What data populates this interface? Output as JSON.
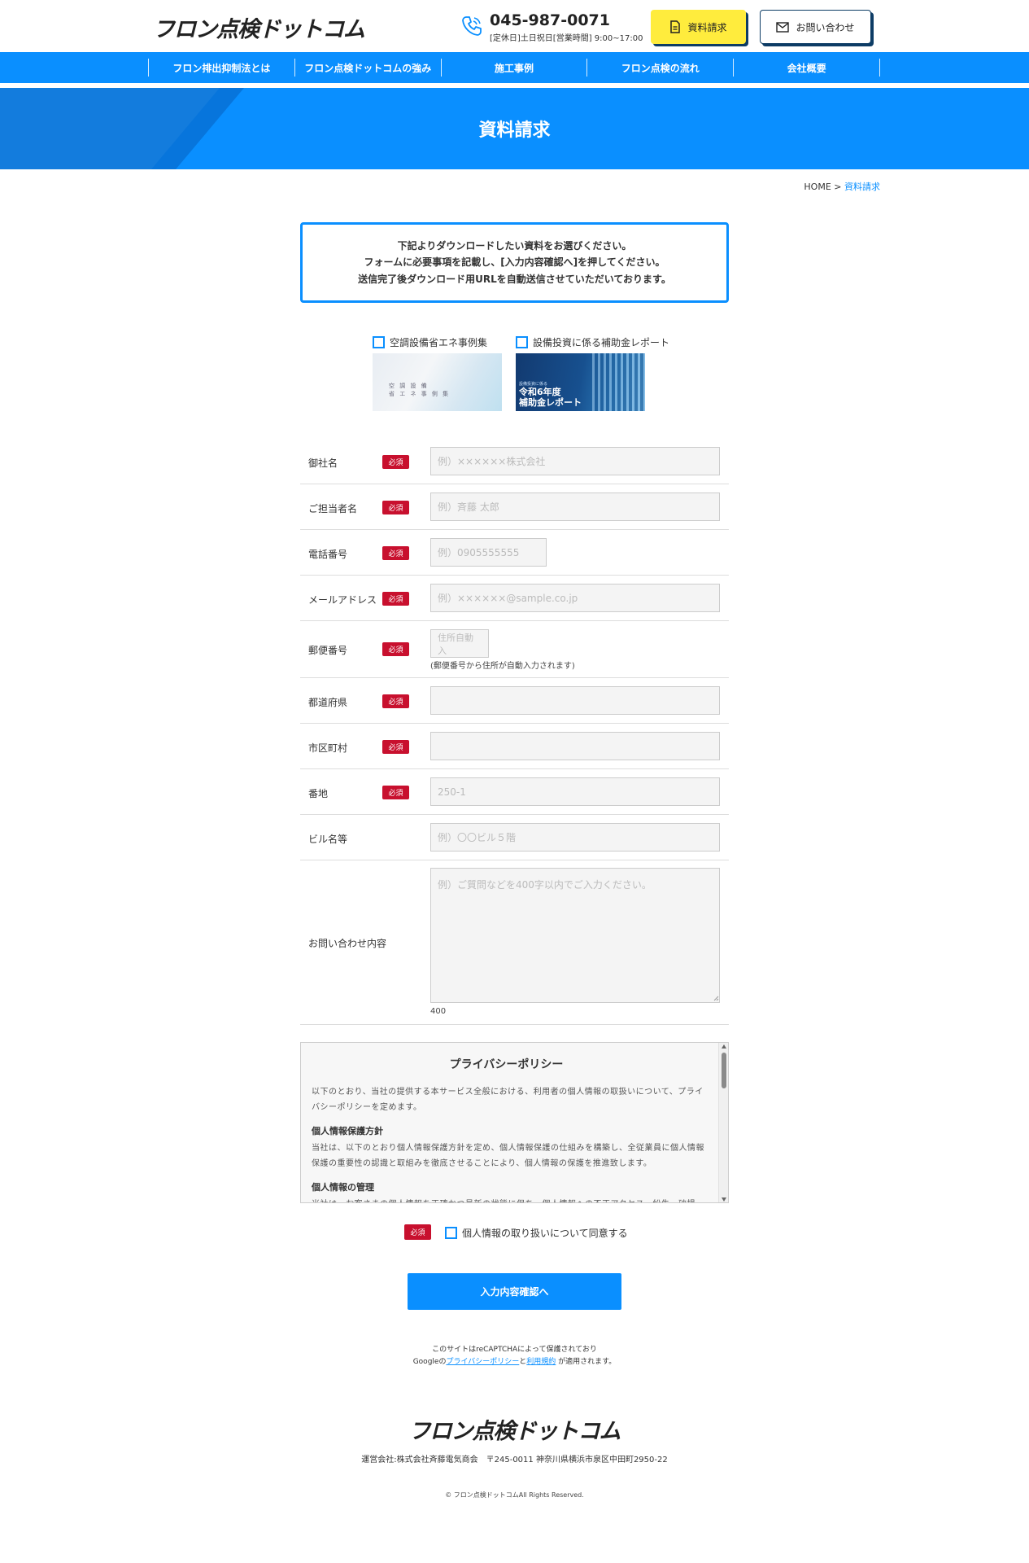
{
  "header": {
    "logo": "フロン点検ドットコム",
    "phone": "045-987-0071",
    "hours": "[定休日]土日祝日[営業時間] 9:00~17:00",
    "doc_button": "資料請求",
    "contact_button": "お問い合わせ",
    "accent_yellow": "#ffec3d",
    "accent_blue": "#0a8fff",
    "phone_icon": "phone-icon",
    "doc_icon": "document-icon",
    "mail_icon": "mail-icon"
  },
  "nav": {
    "items": [
      "フロン排出抑制法とは",
      "フロン点検ドットコムの強み",
      "施工事例",
      "フロン点検の流れ",
      "会社概要"
    ]
  },
  "hero": {
    "title": "資料請求"
  },
  "breadcrumb": {
    "home": "HOME",
    "separator": ">",
    "current": "資料請求"
  },
  "notice": {
    "lines": [
      "下記よりダウンロードしたい資料をお選びください。",
      "フォームに必要事項を記載し、[入力内容確認へ]を押してください。",
      "送信完了後ダウンロード用URLを自動送信させていただいております。"
    ]
  },
  "documents": [
    {
      "label": "空調設備省エネ事例集",
      "thumb_text": [
        "空 調 設 備",
        "省 エ ネ 事 例 集"
      ]
    },
    {
      "label": "設備投資に係る補助金レポート",
      "thumb_sub": "設備投資に係る",
      "thumb_text": [
        "令和6年度",
        "補助金レポート"
      ]
    }
  ],
  "form": {
    "required_badge": "必須",
    "fields": [
      {
        "label": "御社名",
        "placeholder": "例）××××××株式会社"
      },
      {
        "label": "ご担当者名",
        "placeholder": "例）斉藤 太郎"
      },
      {
        "label": "電話番号",
        "placeholder": "例）0905555555"
      },
      {
        "label": "メールアドレス",
        "placeholder": "例）××××××@sample.co.jp"
      },
      {
        "label": "郵便番号",
        "placeholder": "住所自動入",
        "note": "(郵便番号から住所が自動入力されます)"
      },
      {
        "label": "都道府県",
        "placeholder": ""
      },
      {
        "label": "市区町村",
        "placeholder": ""
      },
      {
        "label": "番地",
        "placeholder": "250-1"
      },
      {
        "label": "ビル名等",
        "placeholder": "例）〇〇ビル５階"
      },
      {
        "label": "お問い合わせ内容",
        "placeholder": "例）ご質問などを400字以内でご入力ください。",
        "counter": "400"
      }
    ]
  },
  "privacy": {
    "title": "プライバシーポリシー",
    "intro": "以下のとおり、当社の提供する本サービス全般における、利用者の個人情報の取扱いについて、プライバシーポリシーを定めます。",
    "section1_title": "個人情報保護方針",
    "section1_text": "当社は、以下のとおり個人情報保護方針を定め、個人情報保護の仕組みを構築し、全従業員に個人情報保護の重要性の認識と取組みを徹底させることにより、個人情報の保護を推進致します。",
    "section2_title": "個人情報の管理",
    "section2_text": "当社は、お客さまの個人情報を正確かつ最新の状態に保ち、個人情報への不正アクセス・紛失・破損・改"
  },
  "agree": {
    "badge": "必須",
    "label": "個人情報の取り扱いについて同意する"
  },
  "submit": {
    "label": "入力内容確認へ"
  },
  "recaptcha": {
    "line1": "このサイトはreCAPTCHAによって保護されており",
    "prefix": "Googleの",
    "privacy_link": "プライバシーポリシー",
    "and": "と",
    "terms_link": "利用規約",
    "suffix": " が適用されます。"
  },
  "footer": {
    "logo": "フロン点検ドットコム",
    "address": "運営会社:株式会社斉藤電気商会　〒245-0011 神奈川県横浜市泉区中田町2950-22",
    "copyright": "© フロン点検ドットコムAll Rights Reserved."
  }
}
